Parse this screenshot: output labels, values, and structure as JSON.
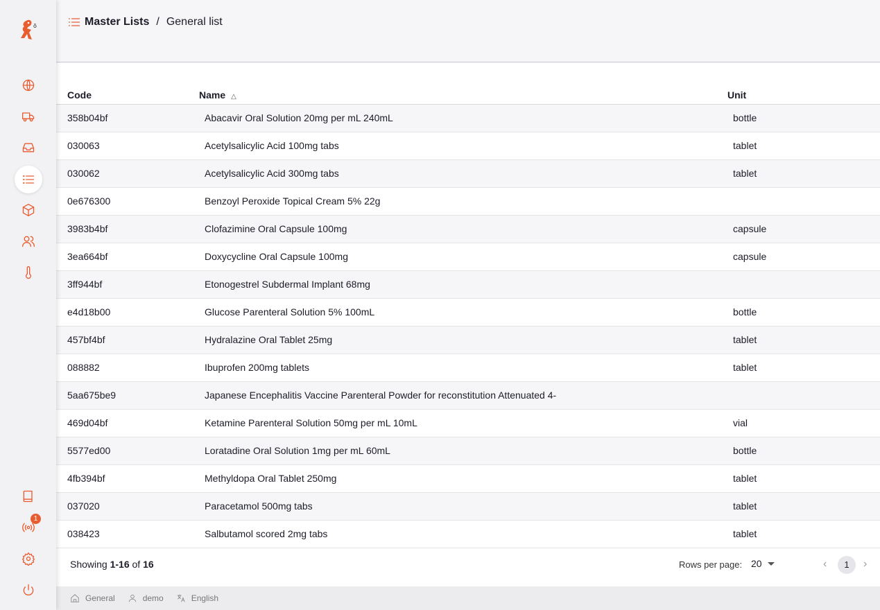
{
  "breadcrumb": {
    "root": "Master Lists",
    "separator": "/",
    "current": "General list"
  },
  "accent_color": "#e95c30",
  "sidebar": {
    "top_items": [
      {
        "icon": "globe-icon",
        "label": "Dashboard"
      },
      {
        "icon": "truck-icon",
        "label": "Distribution"
      },
      {
        "icon": "inbox-icon",
        "label": "Replenishment"
      },
      {
        "icon": "list-icon",
        "label": "Catalogue",
        "active": true
      },
      {
        "icon": "box-icon",
        "label": "Inventory"
      },
      {
        "icon": "users-icon",
        "label": "Patients"
      },
      {
        "icon": "thermometer-icon",
        "label": "Cold Chain"
      }
    ],
    "bottom_items": [
      {
        "icon": "book-icon"
      },
      {
        "icon": "sync-icon",
        "badge": "1"
      },
      {
        "icon": "gear-icon"
      },
      {
        "icon": "power-icon"
      }
    ]
  },
  "table": {
    "headers": {
      "code": "Code",
      "name": "Name",
      "unit": "Unit"
    },
    "sort_indicator": "△",
    "rows": [
      {
        "code": "358b04bf",
        "name": "Abacavir Oral Solution 20mg per mL 240mL",
        "unit": "bottle"
      },
      {
        "code": "030063",
        "name": "Acetylsalicylic Acid 100mg tabs",
        "unit": "tablet"
      },
      {
        "code": "030062",
        "name": "Acetylsalicylic Acid 300mg tabs",
        "unit": "tablet"
      },
      {
        "code": "0e676300",
        "name": "Benzoyl Peroxide Topical Cream 5% 22g",
        "unit": ""
      },
      {
        "code": "3983b4bf",
        "name": "Clofazimine Oral Capsule 100mg",
        "unit": "capsule"
      },
      {
        "code": "3ea664bf",
        "name": "Doxycycline Oral Capsule 100mg",
        "unit": "capsule"
      },
      {
        "code": "3ff944bf",
        "name": "Etonogestrel Subdermal Implant 68mg",
        "unit": ""
      },
      {
        "code": "e4d18b00",
        "name": "Glucose Parenteral Solution 5% 100mL",
        "unit": "bottle"
      },
      {
        "code": "457bf4bf",
        "name": "Hydralazine Oral Tablet 25mg",
        "unit": "tablet"
      },
      {
        "code": "088882",
        "name": "Ibuprofen 200mg tablets",
        "unit": "tablet"
      },
      {
        "code": "5aa675be9",
        "name": "Japanese Encephalitis Vaccine Parenteral Powder for reconstitution Attenuated 4-",
        "unit": ""
      },
      {
        "code": "469d04bf",
        "name": "Ketamine Parenteral Solution 50mg per mL 10mL",
        "unit": "vial"
      },
      {
        "code": "5577ed00",
        "name": "Loratadine Oral Solution 1mg per mL 60mL",
        "unit": "bottle"
      },
      {
        "code": "4fb394bf",
        "name": "Methyldopa Oral Tablet 250mg",
        "unit": "tablet"
      },
      {
        "code": "037020",
        "name": "Paracetamol 500mg tabs",
        "unit": "tablet"
      },
      {
        "code": "038423",
        "name": "Salbutamol scored 2mg tabs",
        "unit": "tablet"
      }
    ]
  },
  "pagination": {
    "showing_prefix": "Showing",
    "range": "1-16",
    "of_label": "of",
    "total": "16",
    "rows_per_page_label": "Rows per page:",
    "rows_per_page": "20",
    "current_page": "1",
    "prev": "‹",
    "next": "›"
  },
  "status": {
    "store": "General",
    "user": "demo",
    "language": "English"
  }
}
